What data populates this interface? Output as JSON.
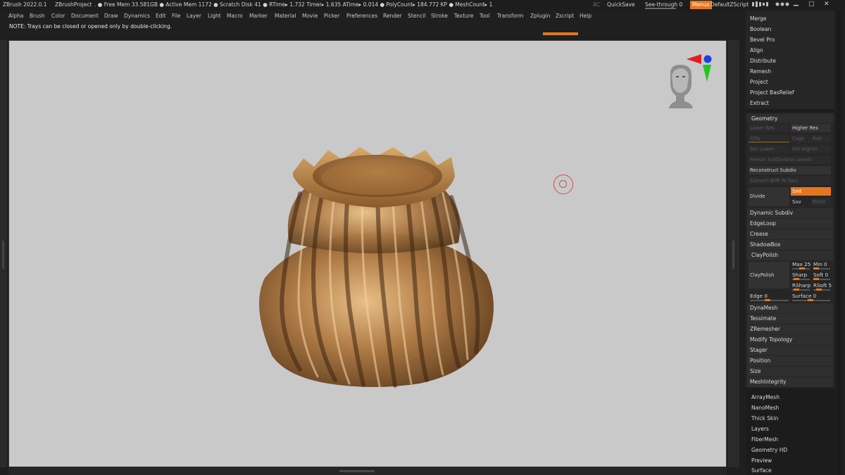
{
  "titlebar": {
    "app": "ZBrush 2022.0.1",
    "project": "ZBrushProject",
    "stats": ". ● Free Mem 33.581GB ● Active Mem 1172 ● Scratch Disk 41 ●  RTime▸ 1.732 Timer▸ 1.635 ATime▸ 0.014 ● PolyCount▸ 184.772 KP  ● MeshCount▸ 1",
    "ac": "AC",
    "quicksave": "QuickSave",
    "see_through": "See-through  0",
    "menus": "Menus",
    "script": "DefaultZScript"
  },
  "menu_items": [
    "Alpha",
    "Brush",
    "Color",
    "Document",
    "Draw",
    "Dynamics",
    "Edit",
    "File",
    "Layer",
    "Light",
    "Macro",
    "Marker",
    "Material",
    "Movie",
    "Picker",
    "Preferences",
    "Render",
    "Stencil",
    "Stroke",
    "Texture",
    "Tool",
    "Transform",
    "Zplugin",
    "Zscript",
    "Help"
  ],
  "note": "NOTE: Trays can be closed or opened only by double-clicking.",
  "plugins": [
    "Merge",
    "Boolean",
    "Bevel Pro",
    "Align",
    "Distribute",
    "Remesh",
    "Project",
    "Project BasRelief",
    "Extract"
  ],
  "geometry": {
    "header": "Geometry",
    "lower_res": "Lower Res",
    "higher_res": "Higher Res",
    "sdiv": "SDiv",
    "cage": "Cage",
    "rstr": "Rstr",
    "del_lower": "Del Lower",
    "del_higher": "Del Higher",
    "freeze": "Freeze SubDivision Levels",
    "reconstruct": "Reconstruct Subdiv",
    "convert": "Convert BPR To Geo",
    "divide": "Divide",
    "smt": "Smt",
    "suv": "Suv",
    "reuv": "ReUV",
    "dynamic_subdiv": "Dynamic Subdiv",
    "edgeloop": "EdgeLoop",
    "crease": "Crease",
    "shadowbox": "ShadowBox",
    "claypolish": "ClayPolish",
    "claypolish_btn": "ClayPolish",
    "max": "Max 25",
    "min": "Min 0",
    "sharp": "Sharp",
    "soft": "Soft 0",
    "rsharp": "RSharp",
    "rsoft": "RSoft 5",
    "edge": "Edge 0",
    "surface": "Surface 0",
    "dynamesh": "DynaMesh",
    "tessimate": "Tessimate",
    "zremesher": "ZRemesher",
    "modify_topology": "Modify Topology",
    "stager": "Stager",
    "position": "Position",
    "size": "Size",
    "meshintegrity": "MeshIntegrity"
  },
  "tool_sections": [
    "ArrayMesh",
    "NanoMesh",
    "Thick Skin",
    "Layers",
    "FiberMesh",
    "Geometry HD",
    "Preview",
    "Surface"
  ],
  "colors": {
    "accent": "#e6761c",
    "viewport_bg": "#c9c9c9",
    "mesh_gold": "#b07a45"
  },
  "icons": {
    "minimize": "minimize-icon",
    "close": "close-icon"
  }
}
